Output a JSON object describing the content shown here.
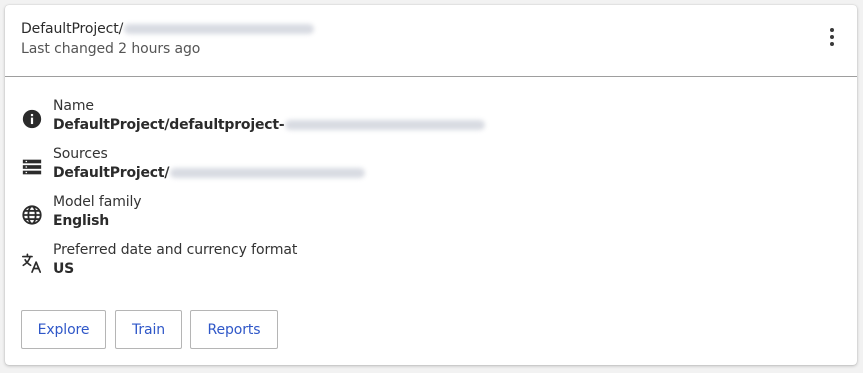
{
  "header": {
    "title": "DefaultProject/",
    "subtitle": "Last changed 2 hours ago"
  },
  "details": {
    "name": {
      "icon": "info-icon",
      "label": "Name",
      "value": "DefaultProject/defaultproject-"
    },
    "sources": {
      "icon": "sources-list-icon",
      "label": "Sources",
      "value": "DefaultProject/"
    },
    "model_family": {
      "icon": "globe-icon",
      "label": "Model family",
      "value": "English"
    },
    "locale": {
      "icon": "translate-icon",
      "label": "Preferred date and currency format",
      "value": "US"
    }
  },
  "actions": {
    "explore": "Explore",
    "train": "Train",
    "reports": "Reports"
  },
  "menu_icon": "more-vertical-icon",
  "colors": {
    "accent": "#2f57c8",
    "divider": "#9e9e9e"
  }
}
